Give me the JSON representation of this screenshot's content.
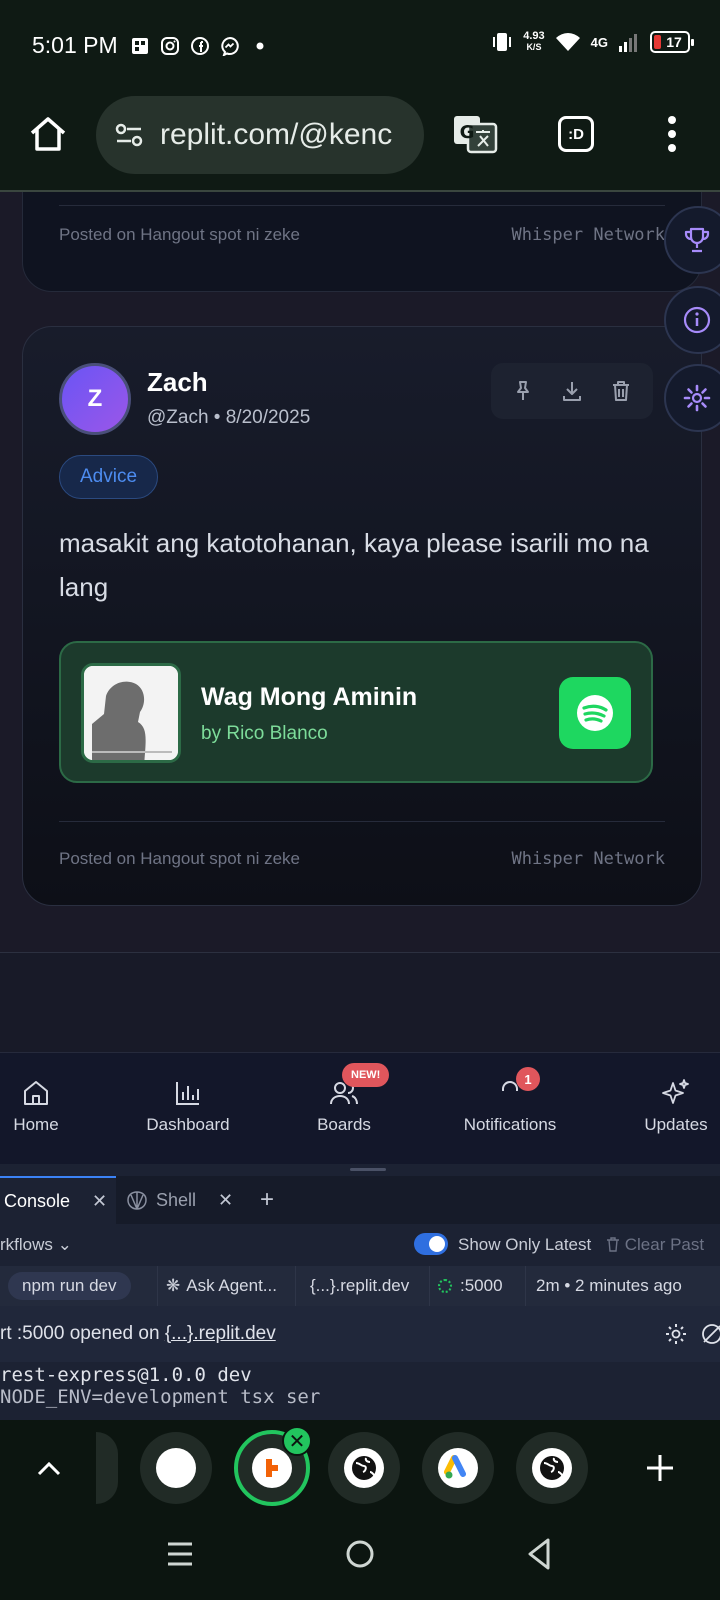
{
  "status_bar": {
    "time": "5:01 PM",
    "net_speed_value": "4.93",
    "net_speed_unit": "K/S",
    "network": "4G",
    "battery": "17"
  },
  "browser": {
    "url": "replit.com/@kenc",
    "tab_switcher_label": ":D"
  },
  "prev_post": {
    "posted_on": "Posted on Hangout spot ni zeke",
    "network": "Whisper Network"
  },
  "post": {
    "avatar_letter": "Z",
    "author": "Zach",
    "meta": "@Zach • 8/20/2025",
    "tag": "Advice",
    "text": "masakit ang katotohanan, kaya please isarili mo na lang",
    "song": {
      "title": "Wag Mong Aminin",
      "artist": "by Rico Blanco"
    },
    "posted_on": "Posted on Hangout spot ni zeke",
    "network": "Whisper Network"
  },
  "bottom_nav": {
    "items": [
      {
        "label": "Home",
        "icon": "home-icon"
      },
      {
        "label": "Dashboard",
        "icon": "bar-chart-icon"
      },
      {
        "label": "Boards",
        "icon": "users-icon",
        "badge": "NEW!"
      },
      {
        "label": "Notifications",
        "icon": "bell-icon",
        "badge": "1"
      },
      {
        "label": "Updates",
        "icon": "sparkles-icon"
      }
    ]
  },
  "console": {
    "tabs": [
      {
        "label": "Console",
        "active": true
      },
      {
        "label": "Shell",
        "active": false
      }
    ],
    "workflows_label": "rkflows",
    "show_only_latest": "Show Only Latest",
    "clear_past": "Clear Past",
    "chips": [
      "npm run dev",
      "Ask Agent...",
      "{...}.replit.dev",
      ":5000",
      "2m • 2 minutes ago"
    ],
    "port_prefix": "rt :5000 opened on ",
    "port_link": "{...}.replit.dev",
    "terminal_line1": "rest-express@1.0.0 dev",
    "terminal_line2": "NODE_ENV=development tsx ser"
  },
  "colors": {
    "accent_green": "#22c55e",
    "spotify_green": "#1ed760",
    "tag_blue": "#4d8cf0",
    "badge_red": "#e0565c"
  }
}
